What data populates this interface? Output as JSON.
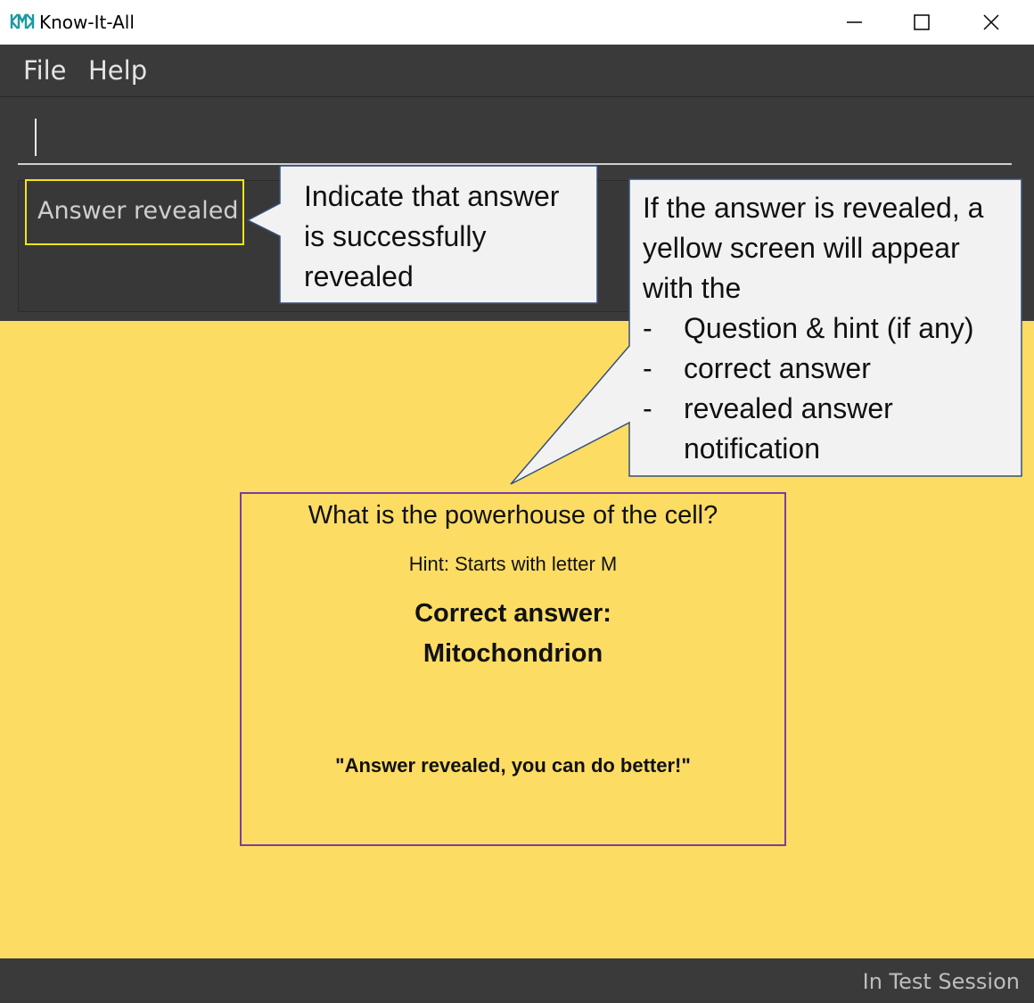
{
  "window": {
    "title": "Know-It-All",
    "controls": [
      "minimize",
      "maximize",
      "close"
    ]
  },
  "menu": {
    "items": [
      "File",
      "Help"
    ]
  },
  "command_box": {
    "value": ""
  },
  "result_display": {
    "text": "Answer revealed"
  },
  "card": {
    "question": "What is the powerhouse of the cell?",
    "hint": "Hint: Starts with letter M",
    "answer_label": "Correct answer:",
    "answer": "Mitochondrion",
    "notification": "\"Answer revealed, you can do better!\""
  },
  "status_bar": {
    "text": "In Test Session"
  },
  "annotations": {
    "callout1": [
      "Indicate that answer",
      "is successfully",
      "revealed"
    ],
    "callout2": {
      "lines": [
        "If the answer is revealed, a",
        "yellow screen will appear",
        "with the"
      ],
      "bullets": [
        "Question & hint (if any)",
        "correct answer",
        "revealed answer",
        "notification"
      ],
      "dash": "-"
    }
  },
  "colors": {
    "dark_bg": "#3a3a3a",
    "yellow_bg": "#fcdc63",
    "result_border": "#f2e418",
    "card_border": "#7a3da0",
    "callout_bg": "#f2f2f2"
  }
}
